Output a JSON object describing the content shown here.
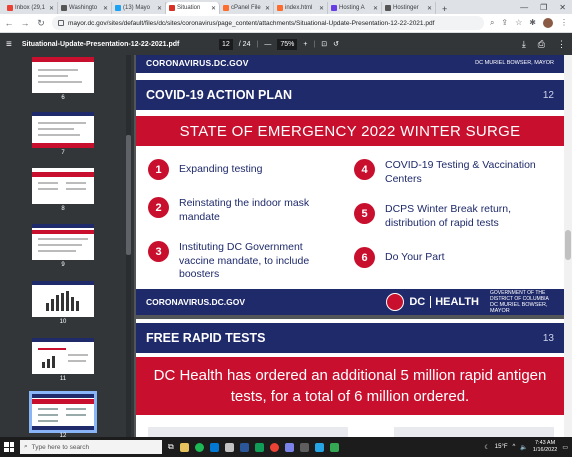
{
  "browser": {
    "tabs": [
      {
        "label": "Inbox (29,1",
        "color": "#ea4335"
      },
      {
        "label": "Washingto",
        "color": "#555555"
      },
      {
        "label": "(13) Mayo",
        "color": "#1da1f2"
      },
      {
        "label": "Situation",
        "color": "#d93025",
        "active": true
      },
      {
        "label": "cPanel File",
        "color": "#ff6c2c"
      },
      {
        "label": "index.html",
        "color": "#ff6c2c"
      },
      {
        "label": "Hosting A",
        "color": "#673de6"
      },
      {
        "label": "Hostinger",
        "color": "#555555"
      }
    ],
    "url": "mayor.dc.gov/sites/default/files/dc/sites/coronavirus/page_content/attachments/Situational-Update-Presentation-12-22-2021.pdf"
  },
  "pdf": {
    "filename": "Situational-Update-Presentation-12-22-2021.pdf",
    "current_page": "12",
    "total_pages": "/ 24",
    "zoom": "75%"
  },
  "sidebar": {
    "thumbs": [
      "6",
      "7",
      "8",
      "9",
      "10",
      "11",
      "12"
    ]
  },
  "slide12": {
    "top_footer": "CORONAVIRUS.DC.GOV",
    "title": "COVID-19 ACTION PLAN",
    "page": "12",
    "banner": "STATE OF EMERGENCY 2022 WINTER SURGE",
    "items": [
      {
        "num": "1",
        "text": "Expanding testing"
      },
      {
        "num": "2",
        "text": "Reinstating the indoor mask mandate"
      },
      {
        "num": "3",
        "text": "Instituting DC Government vaccine mandate, to include boosters"
      },
      {
        "num": "4",
        "text": "COVID-19 Testing & Vaccination Centers"
      },
      {
        "num": "5",
        "text": "DCPS Winter Break return, distribution of rapid tests"
      },
      {
        "num": "6",
        "text": "Do Your Part"
      }
    ],
    "footer_left": "CORONAVIRUS.DC.GOV",
    "footer_dc": "DC",
    "footer_health": "HEALTH",
    "footer_gov": "GOVERNMENT OF THE DISTRICT OF COLUMBIA",
    "footer_mayor": "DC MURIEL BOWSER, MAYOR"
  },
  "slide13": {
    "title": "FREE RAPID TESTS",
    "page": "13",
    "banner": "DC Health has ordered an additional 5 million rapid antigen tests, for a total of 6 million ordered."
  },
  "taskbar": {
    "search_placeholder": "Type here to search",
    "weather": "15°F",
    "time": "7:43 AM",
    "date": "1/16/2022"
  }
}
